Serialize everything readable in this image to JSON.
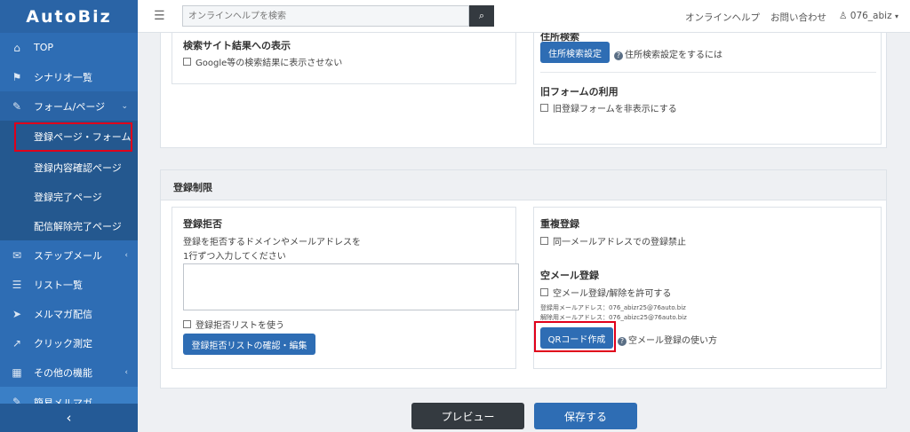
{
  "brand": "AutoBiz",
  "sidebar": {
    "items": [
      {
        "label": "TOP",
        "icon": "home-icon",
        "glyph": "⌂"
      },
      {
        "label": "シナリオ一覧",
        "icon": "flag-icon",
        "glyph": "⚑"
      },
      {
        "label": "フォーム/ページ",
        "icon": "pen-icon",
        "glyph": "✎",
        "caret": "⌄"
      },
      {
        "label": "登録ページ・フォーム"
      },
      {
        "label": "登録内容確認ページ"
      },
      {
        "label": "登録完了ページ"
      },
      {
        "label": "配信解除完了ページ"
      },
      {
        "label": "ステップメール",
        "icon": "envelope-open-icon",
        "glyph": "✉",
        "caret": "‹"
      },
      {
        "label": "リスト一覧",
        "icon": "list-icon",
        "glyph": "☰"
      },
      {
        "label": "メルマガ配信",
        "icon": "send-icon",
        "glyph": "➤"
      },
      {
        "label": "クリック測定",
        "icon": "chart-icon",
        "glyph": "↗"
      },
      {
        "label": "その他の機能",
        "icon": "grid-icon",
        "glyph": "▦",
        "caret": "‹"
      },
      {
        "label": "簡易メルマガ",
        "icon": "pen-icon",
        "glyph": "✎"
      }
    ],
    "collapse": "‹"
  },
  "topbar": {
    "menu": "☰",
    "search_placeholder": "オンラインヘルプを検索",
    "search_icon": "⌕",
    "help": "オンラインヘルプ",
    "contact": "お問い合わせ",
    "user": "076_abiz",
    "user_icon": "♙",
    "caret": "▾"
  },
  "settings": {
    "search_title": "検索サイト結果への表示",
    "search_check": "Google等の検索結果に表示させない",
    "address_title": "住所検索",
    "address_btn": "住所検索設定",
    "address_help": "住所検索設定をするには",
    "old_title": "旧フォームの利用",
    "old_check": "旧登録フォームを非表示にする"
  },
  "restrict": {
    "header": "登録制限",
    "reject_title": "登録拒否",
    "reject_desc1": "登録を拒否するドメインやメールアドレスを",
    "reject_desc2": "1行ずつ入力してください",
    "reject_check": "登録拒否リストを使う",
    "reject_btn": "登録拒否リストの確認・編集",
    "dup_title": "重複登録",
    "dup_check": "同一メールアドレスでの登録禁止",
    "empty_title": "空メール登録",
    "empty_check": "空メール登録/解除を許可する",
    "reg_addr": "登録用メールアドレス：076_abizr25@76auto.biz",
    "unsub_addr": "解除用メールアドレス：076_abizc25@76auto.biz",
    "qr_btn": "QRコード作成",
    "empty_help": "空メール登録の使い方"
  },
  "footer": {
    "preview": "プレビュー",
    "save": "保存する"
  },
  "colors": {
    "sidebar": "#2e6db4",
    "accent": "#2e6db4",
    "highlight": "#e0001a",
    "dark": "#343a40"
  }
}
